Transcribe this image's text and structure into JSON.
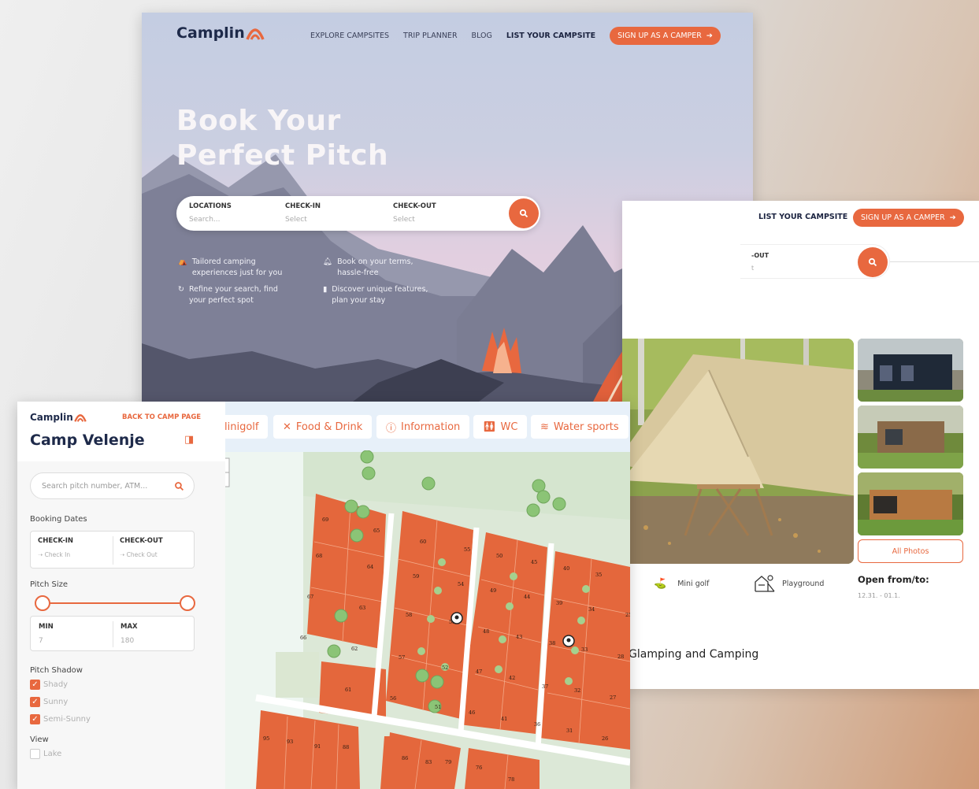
{
  "brand": {
    "name": "Camplin",
    "accent": "#e8683f",
    "navy": "#1e2a4a"
  },
  "hero": {
    "nav": {
      "items": [
        "EXPLORE CAMPSITES",
        "TRIP PLANNER",
        "BLOG"
      ],
      "list_campsite": "LIST YOUR CAMPSITE",
      "signup": "SIGN UP AS A CAMPER"
    },
    "title_line1": "Book Your",
    "title_line2": "Perfect Pitch",
    "search": {
      "locations_label": "LOCATIONS",
      "locations_placeholder": "Search...",
      "checkin_label": "CHECK-IN",
      "checkin_value": "Select",
      "checkout_label": "CHECK-OUT",
      "checkout_value": "Select"
    },
    "features": [
      {
        "icon": "tent-icon",
        "line1": "Tailored camping",
        "line2": "experiences just for you"
      },
      {
        "icon": "bell-icon",
        "line1": "Book on your terms,",
        "line2": "hassle-free"
      },
      {
        "icon": "refresh-icon",
        "line1": "Refine your search, find",
        "line2": "your perfect spot"
      },
      {
        "icon": "note-icon",
        "line1": "Discover unique features,",
        "line2": "plan your stay"
      }
    ]
  },
  "detail": {
    "list_campsite": "LIST YOUR CAMPSITE",
    "signup": "SIGN UP AS A CAMPER",
    "checkout_partial": "-OUT",
    "checkout_value_partial": "t",
    "all_photos": "All Photos",
    "amenities": [
      {
        "icon": "mini-golf-icon",
        "label": "Mini golf"
      },
      {
        "icon": "playground-icon",
        "label": "Playground"
      }
    ],
    "open_title": "Open from/to:",
    "open_dates": "12.31. - 01.1.",
    "section_heading": "Glamping and Camping"
  },
  "map_page": {
    "back_link": "BACK TO CAMP PAGE",
    "camp_title": "Camp Velenje",
    "search_placeholder": "Search pitch number, ATM...",
    "booking_dates_label": "Booking Dates",
    "checkin_label": "CHECK-IN",
    "checkin_placeholder": "Check In",
    "checkout_label": "CHECK-OUT",
    "checkout_placeholder": "Check Out",
    "pitch_size_label": "Pitch Size",
    "min_label": "MIN",
    "min_value": "7",
    "max_label": "MAX",
    "max_value": "180",
    "slider_min_fraction": 0.0,
    "slider_max_fraction": 1.0,
    "shadow_label": "Pitch Shadow",
    "shadow_options": [
      {
        "label": "Shady",
        "checked": true
      },
      {
        "label": "Sunny",
        "checked": true
      },
      {
        "label": "Semi-Sunny",
        "checked": true
      }
    ],
    "view_label": "View",
    "view_options": [
      {
        "label": "Lake",
        "checked": false
      }
    ],
    "filters": [
      {
        "icon": "",
        "label": "linigolf"
      },
      {
        "icon": "cutlery-icon",
        "label": "Food & Drink"
      },
      {
        "icon": "info-icon",
        "label": "Information"
      },
      {
        "icon": "wc-icon",
        "label": "WC"
      },
      {
        "icon": "water-icon",
        "label": "Water sports"
      }
    ],
    "zoom_in": "+",
    "zoom_out": "−",
    "pitch_numbers": [
      "69",
      "65",
      "68",
      "64",
      "67",
      "63",
      "66",
      "62",
      "61",
      "60",
      "59",
      "58",
      "57",
      "56",
      "55",
      "54",
      "53",
      "52",
      "51",
      "50",
      "49",
      "48",
      "47",
      "46",
      "45",
      "44",
      "43",
      "42",
      "41",
      "40",
      "39",
      "38",
      "37",
      "36",
      "35",
      "34",
      "33",
      "32",
      "31",
      "28",
      "27",
      "26",
      "25",
      "95",
      "93",
      "91",
      "88",
      "86",
      "83",
      "79",
      "76",
      "78"
    ]
  }
}
